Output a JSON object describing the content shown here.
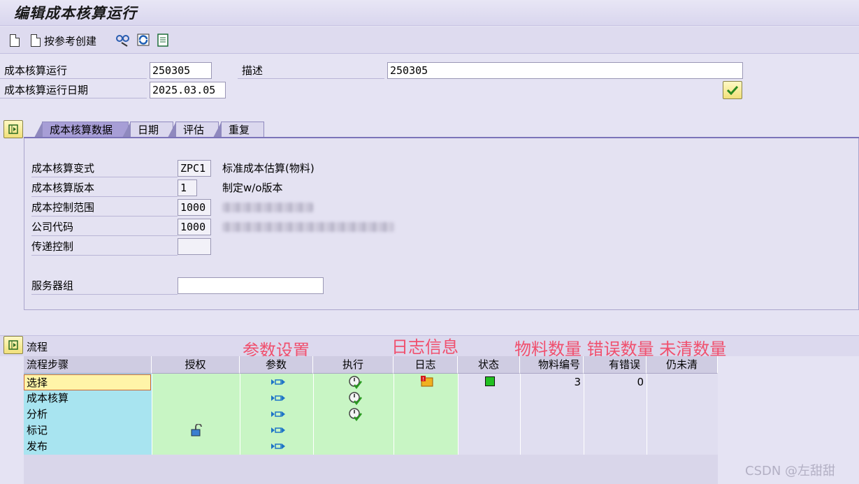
{
  "title": "编辑成本核算运行",
  "toolbar": {
    "create_by_ref_label": "按参考创建"
  },
  "header": {
    "run_label": "成本核算运行",
    "run_value": "250305",
    "desc_label": "描述",
    "desc_value": "250305",
    "date_label": "成本核算运行日期",
    "date_value": "2025.03.05"
  },
  "tabs": [
    {
      "label": "成本核算数据"
    },
    {
      "label": "日期"
    },
    {
      "label": "评估"
    },
    {
      "label": "重复"
    }
  ],
  "panel": {
    "variant_label": "成本核算变式",
    "variant_value": "ZPC1",
    "variant_desc": "标准成本估算(物料)",
    "version_label": "成本核算版本",
    "version_value": "1",
    "version_desc": "制定w/o版本",
    "area_label": "成本控制范围",
    "area_value": "1000",
    "company_label": "公司代码",
    "company_value": "1000",
    "transfer_label": "传递控制",
    "transfer_value": "",
    "server_label": "服务器组",
    "server_value": ""
  },
  "flow": {
    "title": "流程",
    "annotations": {
      "params": "参数设置",
      "log": "日志信息",
      "counts": "物料数量 错误数量 未清数量"
    },
    "columns": [
      "流程步骤",
      "授权",
      "参数",
      "执行",
      "日志",
      "状态",
      "物料编号",
      "有错误",
      "仍未清"
    ],
    "rows": [
      {
        "step": "选择",
        "materials": "3",
        "errors": "0"
      },
      {
        "step": "成本核算",
        "materials": "",
        "errors": ""
      },
      {
        "step": "分析",
        "materials": "",
        "errors": ""
      },
      {
        "step": "标记",
        "materials": "",
        "errors": ""
      },
      {
        "step": "发布",
        "materials": "",
        "errors": ""
      }
    ]
  },
  "watermark": "CSDN @左甜甜",
  "colors": {
    "step_cell": "#a8e4f0",
    "green_cell": "#c8f5c4",
    "status_ok": "#22c022",
    "annotation": "#f0506e"
  }
}
